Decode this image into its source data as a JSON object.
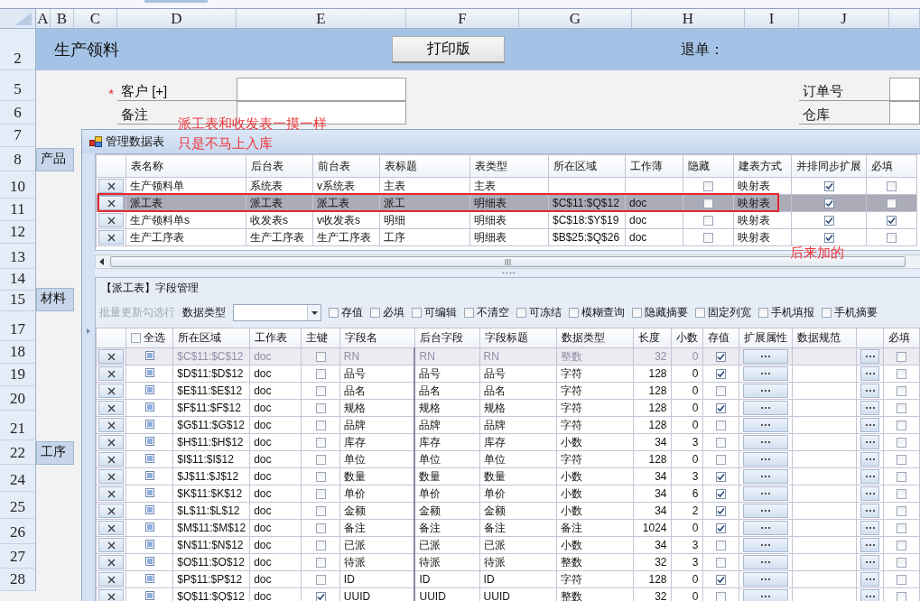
{
  "sheet": {
    "columns": [
      "A",
      "B",
      "C",
      "D",
      "E",
      "F",
      "G",
      "H",
      "I",
      "J",
      ""
    ],
    "rows": [
      "2",
      "5",
      "6",
      "7",
      "8",
      "10",
      "11",
      "12",
      "13",
      "14",
      "15",
      "17",
      "18",
      "19",
      "20",
      "21",
      "22",
      "24",
      "25",
      "26",
      "27",
      "28"
    ],
    "title": "生产领料",
    "print_button": "打印版",
    "return_label": "退单：",
    "form_left": [
      {
        "label": "客户 [+]",
        "marker": "*"
      },
      {
        "label": "备注"
      }
    ],
    "form_right": [
      {
        "label": "订单号"
      },
      {
        "label": "仓库"
      }
    ],
    "section_tabs": [
      "产品",
      "材料",
      "工序"
    ]
  },
  "annotations": [
    "派工表和收发表一摸一样",
    "只是不马上入库",
    "后来加的"
  ],
  "dialog": {
    "title": "管理数据表",
    "tables": {
      "columns": [
        "表名称",
        "后台表",
        "前台表",
        "表标题",
        "表类型",
        "所在区域",
        "工作薄",
        "隐藏",
        "建表方式",
        "并排同步扩展",
        "必填"
      ],
      "rows": [
        {
          "name": "生产领料单",
          "backend": "系统表",
          "frontend": "v系统表",
          "title": "主表",
          "type": "主表",
          "hidden": false,
          "method": "映射表",
          "sync": true,
          "required": false,
          "selected": false,
          "highlighted": false
        },
        {
          "name": "派工表",
          "backend": "派工表",
          "frontend": "派工表",
          "title": "派工",
          "type": "明细表",
          "range": "$C$11:$Q$12",
          "workbook": "doc",
          "hidden": false,
          "method": "映射表",
          "sync": true,
          "required": false,
          "selected": true,
          "highlighted": true
        },
        {
          "name": "生产领料单s",
          "backend": "收发表s",
          "frontend": "v收发表s",
          "title": "明细",
          "type": "明细表",
          "range": "$C$18:$Y$19",
          "workbook": "doc",
          "hidden": false,
          "method": "映射表",
          "sync": true,
          "required": true,
          "selected": false,
          "highlighted": false
        },
        {
          "name": "生产工序表",
          "backend": "生产工序表",
          "frontend": "生产工序表",
          "title": "工序",
          "type": "明细表",
          "range": "$B$25:$Q$26",
          "workbook": "doc",
          "hidden": false,
          "method": "映射表",
          "sync": true,
          "required": false,
          "selected": false,
          "highlighted": false
        }
      ]
    },
    "fields": {
      "heading": "【派工表】字段管理",
      "batch_button": {
        "label": "批量更新勾选行",
        "disabled": true
      },
      "type_filter": {
        "label": "数据类型"
      },
      "options": [
        {
          "label": "存值",
          "checked": false
        },
        {
          "label": "必填",
          "checked": false
        },
        {
          "label": "可编辑",
          "checked": false
        },
        {
          "label": "不清空",
          "checked": false
        },
        {
          "label": "可冻结",
          "checked": false
        },
        {
          "label": "模糊查询",
          "checked": false
        },
        {
          "label": "隐藏摘要",
          "checked": false
        },
        {
          "label": "固定列宽",
          "checked": false
        },
        {
          "label": "手机填报",
          "checked": false
        },
        {
          "label": "手机摘要",
          "checked": false
        }
      ],
      "select_all": {
        "label": "全选",
        "checked": false
      },
      "columns": [
        "所在区域",
        "工作表",
        "主键",
        "字段名",
        "后台字段",
        "字段标题",
        "数据类型",
        "长度",
        "小数",
        "存值",
        "扩展属性",
        "数据规范",
        "必填"
      ],
      "rows": [
        {
          "range": "$C$11:$C$12",
          "sheet": "doc",
          "key": false,
          "name": "RN",
          "backend": "RN",
          "title": "RN",
          "type": "整数",
          "length": "32",
          "decimals": "0",
          "stored": true,
          "required": false,
          "disabled": true
        },
        {
          "range": "$D$11:$D$12",
          "sheet": "doc",
          "key": false,
          "name": "品号",
          "backend": "品号",
          "title": "品号",
          "type": "字符",
          "length": "128",
          "decimals": "0",
          "stored": true,
          "required": false,
          "disabled": false
        },
        {
          "range": "$E$11:$E$12",
          "sheet": "doc",
          "key": false,
          "name": "品名",
          "backend": "品名",
          "title": "品名",
          "type": "字符",
          "length": "128",
          "decimals": "0",
          "stored": false,
          "required": false,
          "disabled": false
        },
        {
          "range": "$F$11:$F$12",
          "sheet": "doc",
          "key": false,
          "name": "规格",
          "backend": "规格",
          "title": "规格",
          "type": "字符",
          "length": "128",
          "decimals": "0",
          "stored": true,
          "required": false,
          "disabled": false
        },
        {
          "range": "$G$11:$G$12",
          "sheet": "doc",
          "key": false,
          "name": "品牌",
          "backend": "品牌",
          "title": "品牌",
          "type": "字符",
          "length": "128",
          "decimals": "0",
          "stored": false,
          "required": false,
          "disabled": false
        },
        {
          "range": "$H$11:$H$12",
          "sheet": "doc",
          "key": false,
          "name": "库存",
          "backend": "库存",
          "title": "库存",
          "type": "小数",
          "length": "34",
          "decimals": "3",
          "stored": false,
          "required": false,
          "disabled": false
        },
        {
          "range": "$I$11:$I$12",
          "sheet": "doc",
          "key": false,
          "name": "单位",
          "backend": "单位",
          "title": "单位",
          "type": "字符",
          "length": "128",
          "decimals": "0",
          "stored": false,
          "required": false,
          "disabled": false
        },
        {
          "range": "$J$11:$J$12",
          "sheet": "doc",
          "key": false,
          "name": "数量",
          "backend": "数量",
          "title": "数量",
          "type": "小数",
          "length": "34",
          "decimals": "3",
          "stored": true,
          "required": false,
          "disabled": false
        },
        {
          "range": "$K$11:$K$12",
          "sheet": "doc",
          "key": false,
          "name": "单价",
          "backend": "单价",
          "title": "单价",
          "type": "小数",
          "length": "34",
          "decimals": "6",
          "stored": true,
          "required": false,
          "disabled": false
        },
        {
          "range": "$L$11:$L$12",
          "sheet": "doc",
          "key": false,
          "name": "金额",
          "backend": "金额",
          "title": "金额",
          "type": "小数",
          "length": "34",
          "decimals": "2",
          "stored": true,
          "required": false,
          "disabled": false
        },
        {
          "range": "$M$11:$M$12",
          "sheet": "doc",
          "key": false,
          "name": "备注",
          "backend": "备注",
          "title": "备注",
          "type": "备注",
          "length": "1024",
          "decimals": "0",
          "stored": true,
          "required": false,
          "disabled": false
        },
        {
          "range": "$N$11:$N$12",
          "sheet": "doc",
          "key": false,
          "name": "已派",
          "backend": "已派",
          "title": "已派",
          "type": "小数",
          "length": "34",
          "decimals": "3",
          "stored": false,
          "required": false,
          "disabled": false
        },
        {
          "range": "$O$11:$O$12",
          "sheet": "doc",
          "key": false,
          "name": "待派",
          "backend": "待派",
          "title": "待派",
          "type": "整数",
          "length": "32",
          "decimals": "3",
          "stored": false,
          "required": false,
          "disabled": false
        },
        {
          "range": "$P$11:$P$12",
          "sheet": "doc",
          "key": false,
          "name": "ID",
          "backend": "ID",
          "title": "ID",
          "type": "字符",
          "length": "128",
          "decimals": "0",
          "stored": true,
          "required": false,
          "disabled": false
        },
        {
          "range": "$Q$11:$Q$12",
          "sheet": "doc",
          "key": true,
          "name": "UUID",
          "backend": "UUID",
          "title": "UUID",
          "type": "整数",
          "length": "32",
          "decimals": "0",
          "stored": false,
          "required": false,
          "disabled": false
        }
      ]
    }
  }
}
